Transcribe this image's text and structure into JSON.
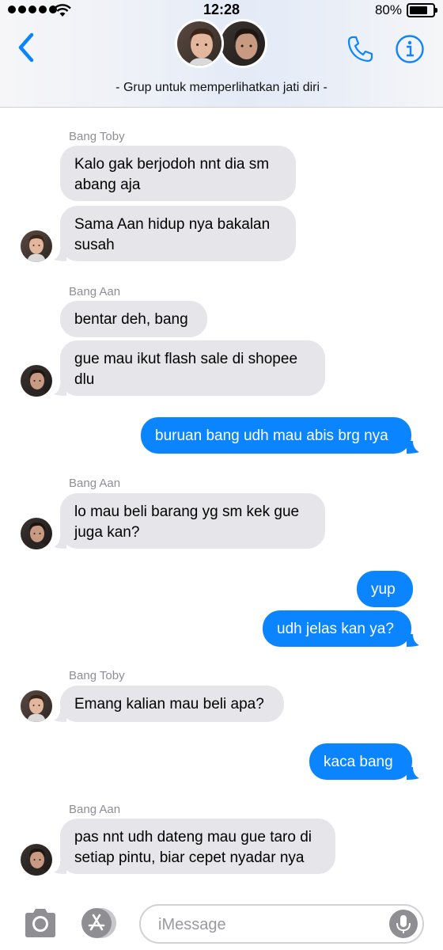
{
  "status_bar": {
    "time": "12:28",
    "battery": "80%",
    "battery_level": 0.8
  },
  "header": {
    "group_name": "- Grup untuk memperlihatkan jati diri -",
    "icons": {
      "back": "chevron-left-icon",
      "call": "phone-icon",
      "info": "info-icon"
    },
    "accent_color": "#0b84ff"
  },
  "messages": [
    {
      "sender": "Bang Toby"
    },
    {
      "lines": [
        "Kalo gak berjodoh nnt dia sm",
        "abang aja"
      ]
    },
    {
      "lines": [
        "Sama Aan hidup nya bakalan",
        "susah"
      ]
    },
    {
      "sender": "Bang Aan"
    },
    {
      "text": "bentar deh, bang"
    },
    {
      "lines": [
        "gue mau ikut flash sale di shopee",
        "dlu"
      ]
    },
    {
      "text": "buruan bang udh mau abis brg nya"
    },
    {
      "sender": "Bang Aan"
    },
    {
      "lines": [
        "lo mau beli barang yg sm kek gue",
        "juga kan?"
      ]
    },
    {
      "text": "yup"
    },
    {
      "text": "udh jelas kan ya?"
    },
    {
      "sender": "Bang Toby"
    },
    {
      "text": "Emang kalian mau beli apa?"
    },
    {
      "text": "kaca bang"
    },
    {
      "sender": "Bang Aan"
    },
    {
      "lines": [
        "pas nnt udh dateng mau gue taro di",
        "setiap pintu, biar cepet nyadar nya"
      ]
    }
  ],
  "composer": {
    "placeholder": "iMessage",
    "icons": {
      "camera": "camera-icon",
      "apps": "app-store-icon",
      "mic": "microphone-icon"
    }
  },
  "colors": {
    "incoming_bubble": "#e5e5ea",
    "outgoing_bubble": "#0b84ff",
    "sender_label": "#8e8e93"
  }
}
